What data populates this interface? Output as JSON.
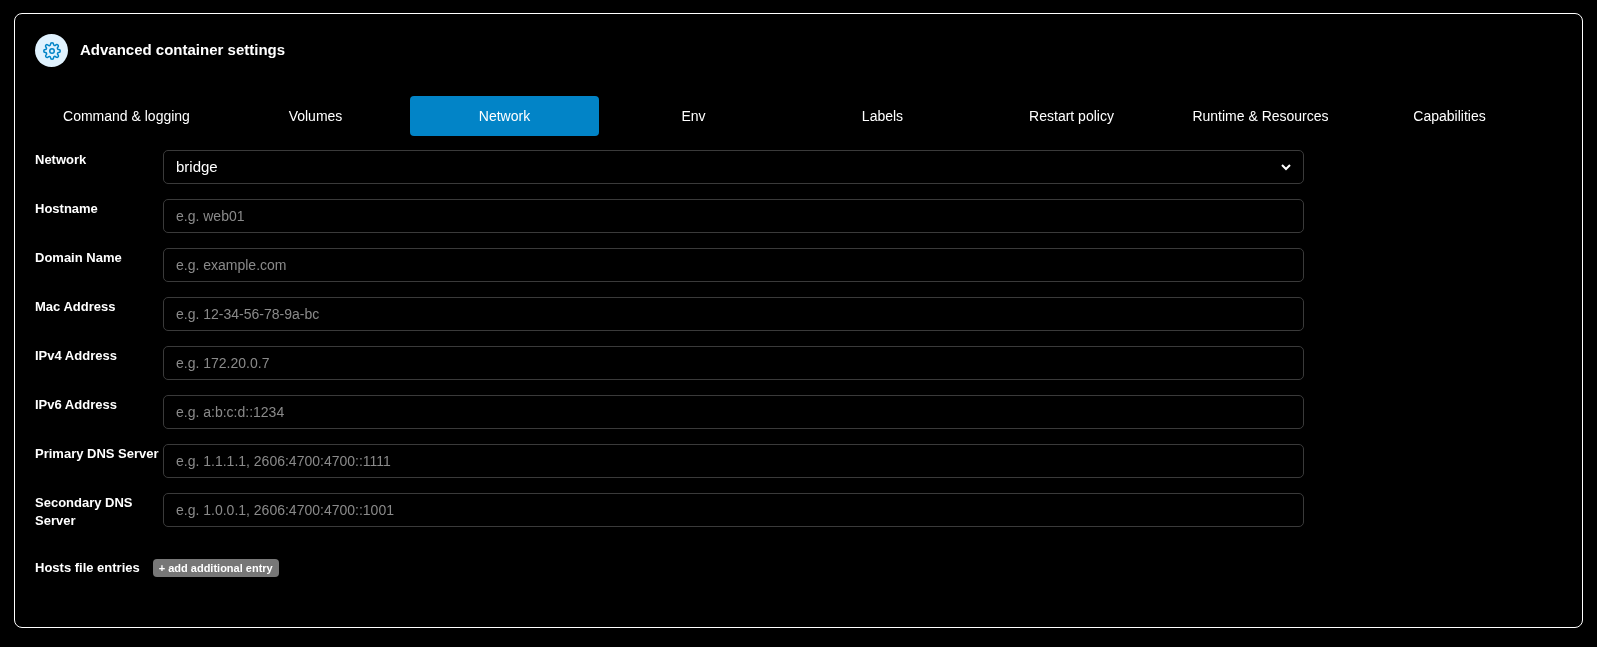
{
  "panel": {
    "title": "Advanced container settings"
  },
  "tabs": [
    {
      "label": "Command & logging",
      "selected": false
    },
    {
      "label": "Volumes",
      "selected": false
    },
    {
      "label": "Network",
      "selected": true
    },
    {
      "label": "Env",
      "selected": false
    },
    {
      "label": "Labels",
      "selected": false
    },
    {
      "label": "Restart policy",
      "selected": false
    },
    {
      "label": "Runtime & Resources",
      "selected": false
    },
    {
      "label": "Capabilities",
      "selected": false
    }
  ],
  "fields": [
    {
      "kind": "select",
      "label": "Network",
      "value": "bridge"
    },
    {
      "kind": "input",
      "label": "Hostname",
      "placeholder": "e.g. web01"
    },
    {
      "kind": "input",
      "label": "Domain Name",
      "placeholder": "e.g. example.com"
    },
    {
      "kind": "input",
      "label": "Mac Address",
      "placeholder": "e.g. 12-34-56-78-9a-bc"
    },
    {
      "kind": "input",
      "label": "IPv4 Address",
      "placeholder": "e.g. 172.20.0.7"
    },
    {
      "kind": "input",
      "label": "IPv6 Address",
      "placeholder": "e.g. a:b:c:d::1234"
    },
    {
      "kind": "input",
      "label": "Primary DNS Server",
      "placeholder": "e.g. 1.1.1.1, 2606:4700:4700::1111"
    },
    {
      "kind": "input",
      "label": "Secondary DNS Server",
      "placeholder": "e.g. 1.0.0.1, 2606:4700:4700::1001"
    }
  ],
  "hosts": {
    "label": "Hosts file entries",
    "button": {
      "icon": "+",
      "label": "add additional entry"
    }
  }
}
